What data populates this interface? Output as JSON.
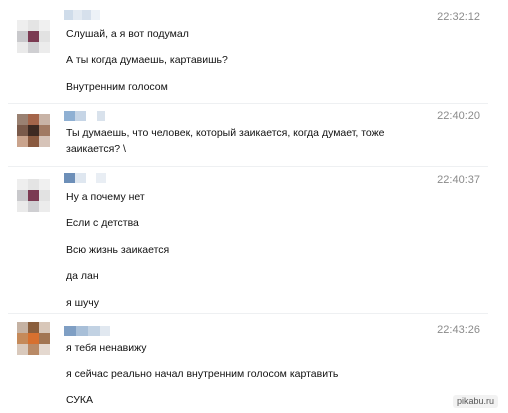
{
  "conversation": [
    {
      "time": "22:32:12",
      "avatar_colors": [
        "#eeeeee",
        "#e4e4e4",
        "#f0f0f0",
        "#c9c9cc",
        "#7b3a52",
        "#e2e2e2",
        "#eaeaea",
        "#cfcfd2",
        "#ececec"
      ],
      "name_colors": [
        "#cfdcea",
        "#e3eaf2",
        "#d6e0ec",
        "#edf2f7"
      ],
      "messages": [
        "Слушай, а я вот подумал",
        "А ты когда думаешь, картавишь?",
        "Внутренним голосом"
      ]
    },
    {
      "time": "22:40:20",
      "avatar_colors": [
        "#9a8172",
        "#a4654a",
        "#c8b3a6",
        "#7a5a4a",
        "#3e2a22",
        "#a17a63",
        "#caa48d",
        "#8a5a40",
        "#d6c3b8"
      ],
      "name_colors": [
        "#8fb0d3",
        "#c6d5e6",
        "#ffffff",
        "#d9e2ec"
      ],
      "messages": [
        "Ты думаешь, что человек, который заикается, когда думает, тоже заикается? \\"
      ]
    },
    {
      "time": "22:40:37",
      "avatar_colors": [
        "#eeeeee",
        "#e4e4e4",
        "#f0f0f0",
        "#c9c9cc",
        "#7b3a52",
        "#e2e2e2",
        "#eaeaea",
        "#cfcfd2",
        "#ececec"
      ],
      "name_colors": [
        "#6d8fb8",
        "#dfe7f0",
        "#ffffff",
        "#e9eef4"
      ],
      "messages": [
        "Ну а почему нет",
        "Если с детства",
        "Всю жизнь заикается",
        "да лан",
        "я шучу"
      ]
    },
    {
      "time": "22:43:26",
      "avatar_colors": [
        "#c5b2a3",
        "#8a5e3c",
        "#d8c7b9",
        "#c58a5a",
        "#d7702f",
        "#a27552",
        "#d9c9bc",
        "#b98a66",
        "#e4d8cf"
      ],
      "name_colors": [
        "#7f9fc4",
        "#a8bfd8",
        "#c2d2e3",
        "#e1e8f0"
      ],
      "messages": [
        "я тебя ненавижу",
        "я сейчас реально начал внутренним голосом картавить",
        "СУКА"
      ]
    }
  ],
  "watermark": "pikabu.ru"
}
